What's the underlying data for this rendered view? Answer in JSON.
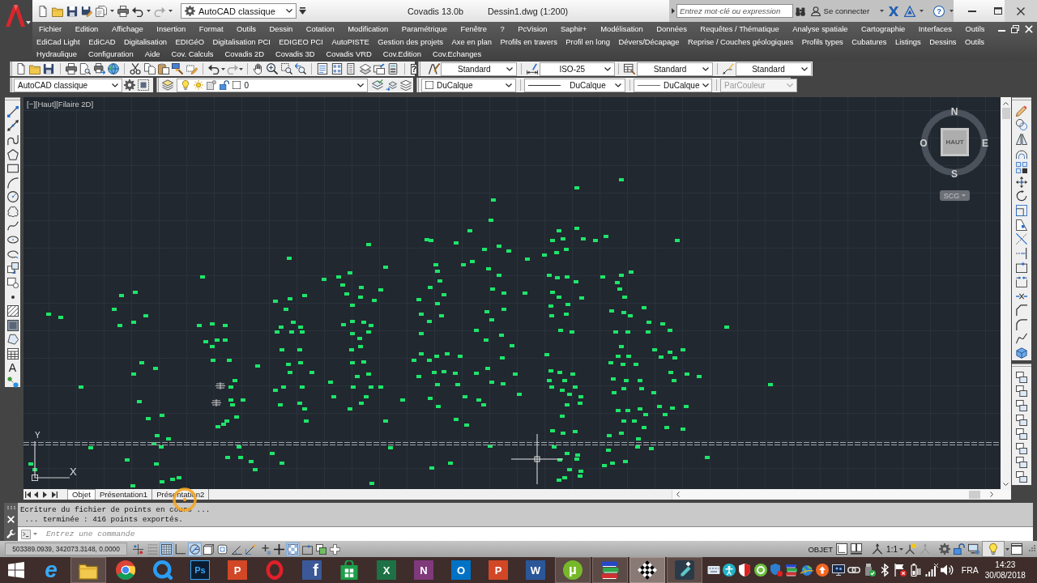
{
  "title_bar": {
    "workspace": "AutoCAD classique",
    "app_name": "Covadis 13.0b",
    "document": "Dessin1.dwg (1:200)",
    "search": {
      "placeholder": "Entrez mot-clé ou expression"
    },
    "sign_in": "Se connecter",
    "help": "?"
  },
  "menus": {
    "line_1": [
      "Fichier",
      "Edition",
      "Affichage",
      "Insertion",
      "Format",
      "Outils",
      "Dessin",
      "Cotation",
      "Modification",
      "Paramétrique",
      "Fenêtre",
      "?",
      "PcVision",
      "Saphir+",
      "Modélisation",
      "Données",
      "Requêtes / Thématique",
      "Analyse spatiale",
      "Cartographie",
      "Interfaces",
      "Outils"
    ],
    "line_2": [
      "EdiCad Light",
      "EdiCAD",
      "Digitalisation",
      "EDIGéO",
      "Digitalisation PCI",
      "EDIGEO PCI",
      "AutoPISTE",
      "Gestion des projets",
      "Axe en plan",
      "Profils en travers",
      "Profil en long",
      "Dévers/Décapage",
      "Reprise / Couches géologiques",
      "Profils types",
      "Cubatures",
      "Listings",
      "Dessins",
      "Outils"
    ],
    "line_3": [
      "Hydraulique",
      "Configuration",
      "Aide",
      "Cov. Calculs",
      "Covadis 2D",
      "Covadis 3D",
      "Covadis VRD",
      "Cov.Edition",
      "Cov.Echanges"
    ]
  },
  "standard_toolbar": {
    "help": "?"
  },
  "styles_toolbar": {
    "text_style": "Standard",
    "dimension_style": "ISO-25",
    "table_style": "Standard",
    "multileader_style": "Standard"
  },
  "properties_toolbar": {
    "workspace": "AutoCAD classique",
    "layer": "0",
    "color_setting": "DuCalque",
    "linetype": "DuCalque",
    "lineweight": "DuCalque",
    "plot_style": {
      "value": "ParCouleur",
      "disabled": true
    }
  },
  "draw_toolbar": {
    "text_tool": "A"
  },
  "viewport": {
    "controls": [
      "[−]",
      "[Haut]",
      "[Filaire 2D]"
    ],
    "viewcube": {
      "face": "HAUT",
      "north": "N",
      "east": "E",
      "south": "S",
      "west": "O"
    },
    "ucs_menu": "SCG",
    "ucs_axes": {
      "y": "Y",
      "x": "X"
    }
  },
  "layout_tabs": [
    {
      "label": "Objet",
      "selected": true
    },
    {
      "label": "Présentation1",
      "selected": false
    },
    {
      "label": "Présentation2",
      "selected": false
    }
  ],
  "command_line": {
    "history": [
      "Ecriture du fichier de points en cours ...",
      " ... terminée : 416 points exportés."
    ],
    "placeholder": "Entrez une commande"
  },
  "status_bar": {
    "coordinates": "503389.0939, 342073.3148, 0.0000",
    "toggles": [
      {
        "on": false
      },
      {
        "on": false
      },
      {
        "on": true
      },
      {
        "on": false
      },
      {
        "on": true
      },
      {
        "on": false
      },
      {
        "on": false
      },
      {
        "on": false
      },
      {
        "on": false
      },
      {
        "on": false
      },
      {
        "on": false
      },
      {
        "on": true
      },
      {
        "on": false
      },
      {
        "on": false
      },
      {
        "on": false
      }
    ],
    "space": "OBJET",
    "annotation_scale": "1:1",
    "isolation": {
      "on": true
    }
  },
  "taskbar": {
    "apps": [
      {
        "glyph": "e",
        "running": false,
        "selected": false
      },
      {
        "running": true,
        "selected": false
      },
      {
        "running": false,
        "selected": false
      },
      {
        "running": false,
        "selected": false
      },
      {
        "glyph": "Ps",
        "running": false,
        "selected": false
      },
      {
        "glyph": "P",
        "running": false,
        "selected": false
      },
      {
        "running": false,
        "selected": false
      },
      {
        "glyph": "f",
        "running": false,
        "selected": false
      },
      {
        "running": false,
        "selected": false
      },
      {
        "glyph": "X",
        "running": false,
        "selected": false
      },
      {
        "glyph": "N",
        "running": false,
        "selected": false
      },
      {
        "glyph": "O",
        "running": false,
        "selected": false
      },
      {
        "glyph": "P",
        "running": false,
        "selected": false
      },
      {
        "glyph": "W",
        "running": false,
        "selected": false
      },
      {
        "glyph": "µ",
        "running": true,
        "selected": false
      },
      {
        "running": true,
        "selected": false
      },
      {
        "running": true,
        "selected": true
      },
      {
        "running": true,
        "selected": false
      }
    ],
    "language": "FRA",
    "time": "14:23",
    "date": "30/08/2018"
  }
}
